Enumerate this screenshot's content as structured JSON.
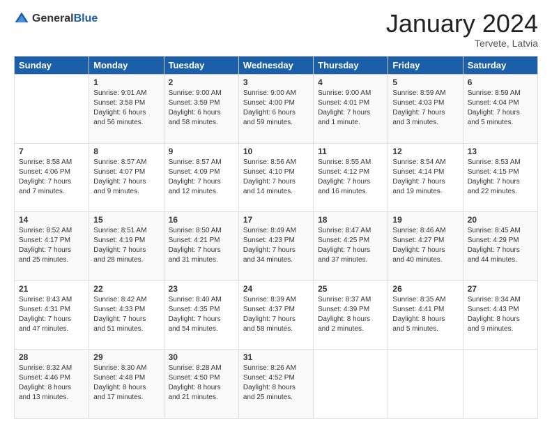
{
  "logo": {
    "general": "General",
    "blue": "Blue"
  },
  "header": {
    "month": "January 2024",
    "location": "Tervete, Latvia"
  },
  "weekdays": [
    "Sunday",
    "Monday",
    "Tuesday",
    "Wednesday",
    "Thursday",
    "Friday",
    "Saturday"
  ],
  "weeks": [
    [
      {
        "day": "",
        "sunrise": "",
        "sunset": "",
        "daylight": ""
      },
      {
        "day": "1",
        "sunrise": "Sunrise: 9:01 AM",
        "sunset": "Sunset: 3:58 PM",
        "daylight": "Daylight: 6 hours and 56 minutes."
      },
      {
        "day": "2",
        "sunrise": "Sunrise: 9:00 AM",
        "sunset": "Sunset: 3:59 PM",
        "daylight": "Daylight: 6 hours and 58 minutes."
      },
      {
        "day": "3",
        "sunrise": "Sunrise: 9:00 AM",
        "sunset": "Sunset: 4:00 PM",
        "daylight": "Daylight: 6 hours and 59 minutes."
      },
      {
        "day": "4",
        "sunrise": "Sunrise: 9:00 AM",
        "sunset": "Sunset: 4:01 PM",
        "daylight": "Daylight: 7 hours and 1 minute."
      },
      {
        "day": "5",
        "sunrise": "Sunrise: 8:59 AM",
        "sunset": "Sunset: 4:03 PM",
        "daylight": "Daylight: 7 hours and 3 minutes."
      },
      {
        "day": "6",
        "sunrise": "Sunrise: 8:59 AM",
        "sunset": "Sunset: 4:04 PM",
        "daylight": "Daylight: 7 hours and 5 minutes."
      }
    ],
    [
      {
        "day": "7",
        "sunrise": "Sunrise: 8:58 AM",
        "sunset": "Sunset: 4:06 PM",
        "daylight": "Daylight: 7 hours and 7 minutes."
      },
      {
        "day": "8",
        "sunrise": "Sunrise: 8:57 AM",
        "sunset": "Sunset: 4:07 PM",
        "daylight": "Daylight: 7 hours and 9 minutes."
      },
      {
        "day": "9",
        "sunrise": "Sunrise: 8:57 AM",
        "sunset": "Sunset: 4:09 PM",
        "daylight": "Daylight: 7 hours and 12 minutes."
      },
      {
        "day": "10",
        "sunrise": "Sunrise: 8:56 AM",
        "sunset": "Sunset: 4:10 PM",
        "daylight": "Daylight: 7 hours and 14 minutes."
      },
      {
        "day": "11",
        "sunrise": "Sunrise: 8:55 AM",
        "sunset": "Sunset: 4:12 PM",
        "daylight": "Daylight: 7 hours and 16 minutes."
      },
      {
        "day": "12",
        "sunrise": "Sunrise: 8:54 AM",
        "sunset": "Sunset: 4:14 PM",
        "daylight": "Daylight: 7 hours and 19 minutes."
      },
      {
        "day": "13",
        "sunrise": "Sunrise: 8:53 AM",
        "sunset": "Sunset: 4:15 PM",
        "daylight": "Daylight: 7 hours and 22 minutes."
      }
    ],
    [
      {
        "day": "14",
        "sunrise": "Sunrise: 8:52 AM",
        "sunset": "Sunset: 4:17 PM",
        "daylight": "Daylight: 7 hours and 25 minutes."
      },
      {
        "day": "15",
        "sunrise": "Sunrise: 8:51 AM",
        "sunset": "Sunset: 4:19 PM",
        "daylight": "Daylight: 7 hours and 28 minutes."
      },
      {
        "day": "16",
        "sunrise": "Sunrise: 8:50 AM",
        "sunset": "Sunset: 4:21 PM",
        "daylight": "Daylight: 7 hours and 31 minutes."
      },
      {
        "day": "17",
        "sunrise": "Sunrise: 8:49 AM",
        "sunset": "Sunset: 4:23 PM",
        "daylight": "Daylight: 7 hours and 34 minutes."
      },
      {
        "day": "18",
        "sunrise": "Sunrise: 8:47 AM",
        "sunset": "Sunset: 4:25 PM",
        "daylight": "Daylight: 7 hours and 37 minutes."
      },
      {
        "day": "19",
        "sunrise": "Sunrise: 8:46 AM",
        "sunset": "Sunset: 4:27 PM",
        "daylight": "Daylight: 7 hours and 40 minutes."
      },
      {
        "day": "20",
        "sunrise": "Sunrise: 8:45 AM",
        "sunset": "Sunset: 4:29 PM",
        "daylight": "Daylight: 7 hours and 44 minutes."
      }
    ],
    [
      {
        "day": "21",
        "sunrise": "Sunrise: 8:43 AM",
        "sunset": "Sunset: 4:31 PM",
        "daylight": "Daylight: 7 hours and 47 minutes."
      },
      {
        "day": "22",
        "sunrise": "Sunrise: 8:42 AM",
        "sunset": "Sunset: 4:33 PM",
        "daylight": "Daylight: 7 hours and 51 minutes."
      },
      {
        "day": "23",
        "sunrise": "Sunrise: 8:40 AM",
        "sunset": "Sunset: 4:35 PM",
        "daylight": "Daylight: 7 hours and 54 minutes."
      },
      {
        "day": "24",
        "sunrise": "Sunrise: 8:39 AM",
        "sunset": "Sunset: 4:37 PM",
        "daylight": "Daylight: 7 hours and 58 minutes."
      },
      {
        "day": "25",
        "sunrise": "Sunrise: 8:37 AM",
        "sunset": "Sunset: 4:39 PM",
        "daylight": "Daylight: 8 hours and 2 minutes."
      },
      {
        "day": "26",
        "sunrise": "Sunrise: 8:35 AM",
        "sunset": "Sunset: 4:41 PM",
        "daylight": "Daylight: 8 hours and 5 minutes."
      },
      {
        "day": "27",
        "sunrise": "Sunrise: 8:34 AM",
        "sunset": "Sunset: 4:43 PM",
        "daylight": "Daylight: 8 hours and 9 minutes."
      }
    ],
    [
      {
        "day": "28",
        "sunrise": "Sunrise: 8:32 AM",
        "sunset": "Sunset: 4:46 PM",
        "daylight": "Daylight: 8 hours and 13 minutes."
      },
      {
        "day": "29",
        "sunrise": "Sunrise: 8:30 AM",
        "sunset": "Sunset: 4:48 PM",
        "daylight": "Daylight: 8 hours and 17 minutes."
      },
      {
        "day": "30",
        "sunrise": "Sunrise: 8:28 AM",
        "sunset": "Sunset: 4:50 PM",
        "daylight": "Daylight: 8 hours and 21 minutes."
      },
      {
        "day": "31",
        "sunrise": "Sunrise: 8:26 AM",
        "sunset": "Sunset: 4:52 PM",
        "daylight": "Daylight: 8 hours and 25 minutes."
      },
      {
        "day": "",
        "sunrise": "",
        "sunset": "",
        "daylight": ""
      },
      {
        "day": "",
        "sunrise": "",
        "sunset": "",
        "daylight": ""
      },
      {
        "day": "",
        "sunrise": "",
        "sunset": "",
        "daylight": ""
      }
    ]
  ]
}
